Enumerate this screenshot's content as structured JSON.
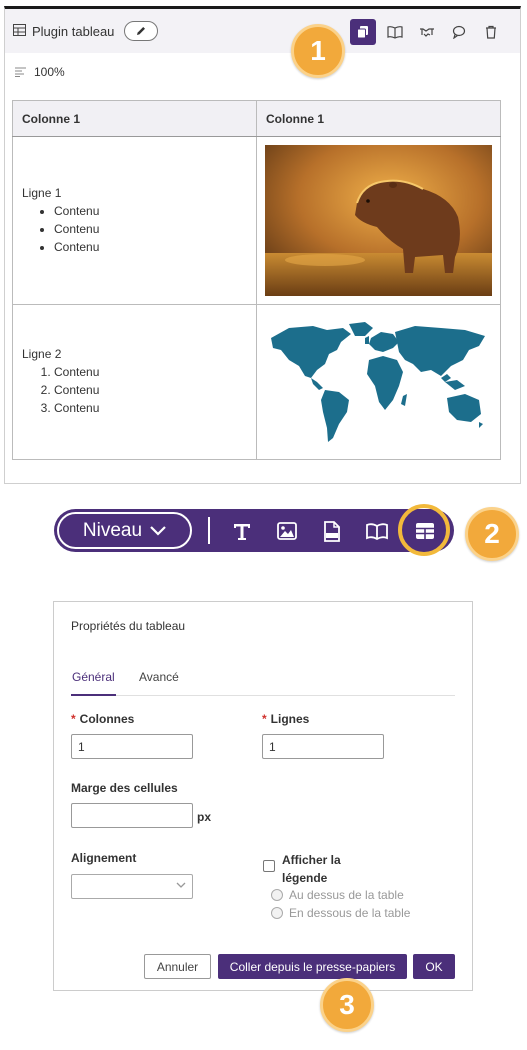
{
  "plugin": {
    "title": "Plugin tableau",
    "zoom": "100%",
    "toolbar_icons": [
      "copy-icon",
      "book-icon",
      "handshake-icon",
      "comment-icon",
      "trash-icon"
    ]
  },
  "table": {
    "headers": [
      "Colonne 1",
      "Colonne 1"
    ],
    "rows": [
      {
        "label": "Ligne 1",
        "list_type": "bullet",
        "items": [
          "Contenu",
          "Contenu",
          "Contenu"
        ],
        "image": "capybara-photo"
      },
      {
        "label": "Ligne 2",
        "list_type": "numbered",
        "items": [
          "Contenu",
          "Contenu",
          "Contenu"
        ],
        "image": "world-map"
      }
    ]
  },
  "editor_toolbar": {
    "niveau_label": "Niveau",
    "tools": [
      "text-icon",
      "image-icon",
      "pdf-icon",
      "book-icon",
      "table-icon"
    ]
  },
  "dialog": {
    "title": "Propriétés du tableau",
    "tabs": [
      "Général",
      "Avancé"
    ],
    "active_tab": "Général",
    "columns_label": "Colonnes",
    "columns_value": "1",
    "rows_label": "Lignes",
    "rows_value": "1",
    "cell_margin_label": "Marge des cellules",
    "cell_margin_value": "",
    "cell_margin_unit": "px",
    "alignment_label": "Alignement",
    "alignment_value": "",
    "caption_label_line1": "Afficher la",
    "caption_label_line2": "légende",
    "caption_checked": false,
    "caption_options": [
      "Au dessus de la table",
      "En dessous de la table"
    ],
    "cancel_label": "Annuler",
    "paste_label": "Coller depuis le presse-papiers",
    "ok_label": "OK"
  },
  "steps": [
    "1",
    "2",
    "3"
  ],
  "colors": {
    "accent": "#4b2f7a",
    "badge": "#f2a93b",
    "required": "#d0312d",
    "map": "#1c6e8c"
  }
}
